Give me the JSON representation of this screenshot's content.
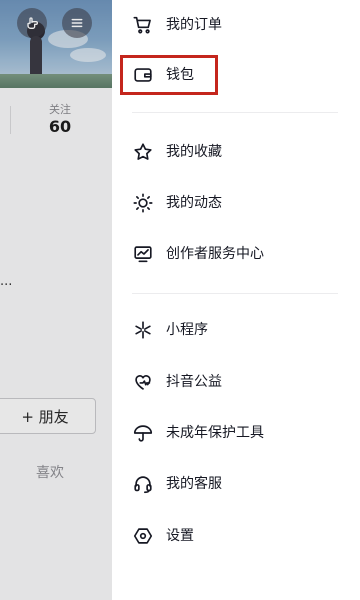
{
  "profile": {
    "stat_label": "关注",
    "stat_value": "60",
    "truncated_text": "...",
    "friend_button": "+ 朋友",
    "like_tab": "喜欢"
  },
  "drawer": {
    "items": [
      {
        "label": "我的订单",
        "icon": "cart-icon"
      },
      {
        "label": "钱包",
        "icon": "wallet-icon"
      },
      {
        "label": "我的收藏",
        "icon": "star-icon"
      },
      {
        "label": "我的动态",
        "icon": "sun-icon"
      },
      {
        "label": "创作者服务中心",
        "icon": "chart-icon"
      },
      {
        "label": "小程序",
        "icon": "asterisk-icon"
      },
      {
        "label": "抖音公益",
        "icon": "charity-heart-icon"
      },
      {
        "label": "未成年保护工具",
        "icon": "umbrella-icon"
      },
      {
        "label": "我的客服",
        "icon": "headset-icon"
      },
      {
        "label": "设置",
        "icon": "settings-hexagon-icon"
      }
    ]
  },
  "colors": {
    "highlight": "#c4261d",
    "text": "#161823",
    "muted": "#8a8a8f"
  }
}
